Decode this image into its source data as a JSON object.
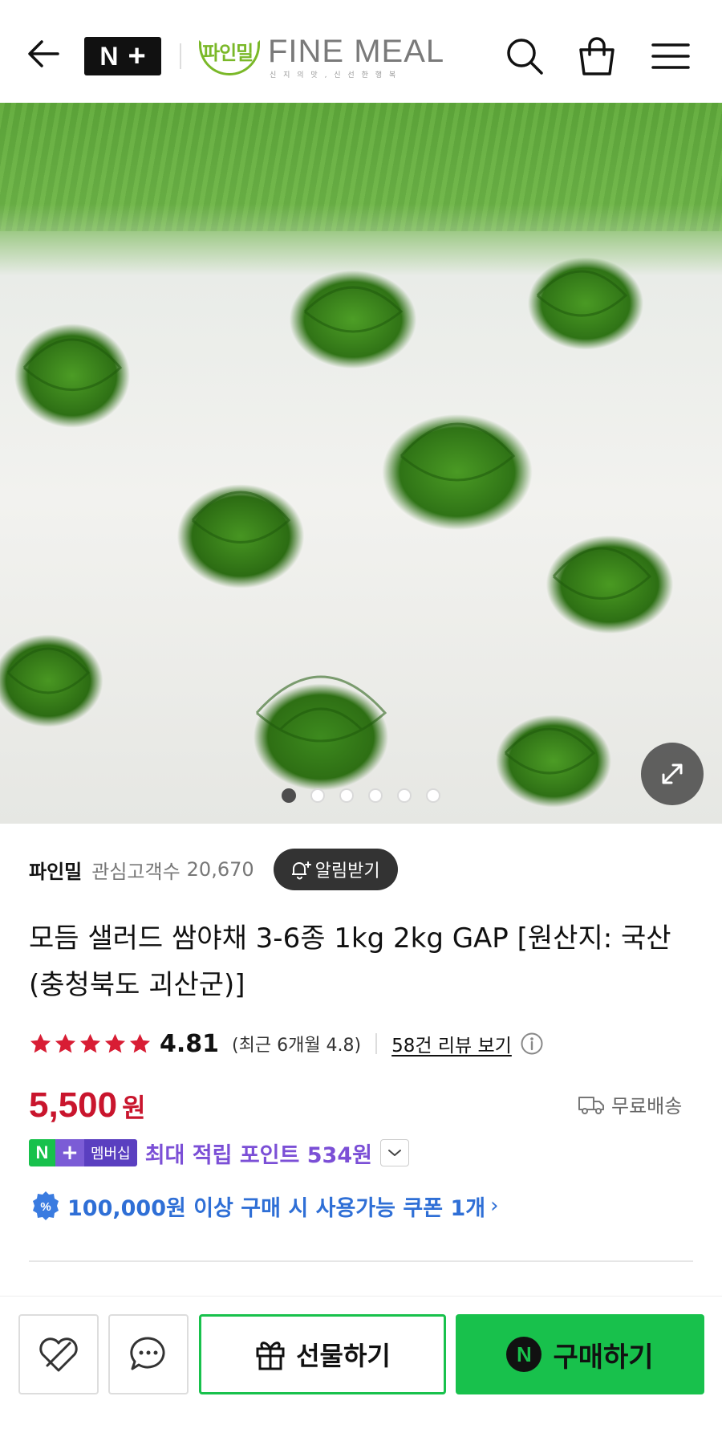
{
  "header": {
    "badge_n": "N",
    "badge_plus": "+",
    "brand_kr": "파인밀",
    "brand_en": "FINE MEAL",
    "brand_sub": "신 지 의 맛 , 신 선 한 행 복"
  },
  "gallery": {
    "dots": 6,
    "active_index": 0
  },
  "seller": {
    "name": "파인밀",
    "fav_label": "관심고객수",
    "fav_count": "20,670",
    "alert_label": "알림받기"
  },
  "product": {
    "title": "모듬 샐러드 쌈야채 3-6종 1kg 2kg GAP [원산지: 국산(충청북도 괴산군)]",
    "rating": {
      "stars": 5,
      "score": "4.81",
      "recent": "(최근 6개월 4.8)",
      "review_link": "58건 리뷰 보기"
    },
    "price": {
      "amount": "5,500",
      "unit": "원"
    },
    "shipping": "무료배송",
    "membership": {
      "badge_n": "N",
      "badge_plus": "+",
      "badge_text": "멤버십",
      "text": "최대 적립 포인트 534원"
    },
    "coupon": {
      "icon_symbol": "%",
      "text": "100,000원 이상 구매 시 사용가능 쿠폰 1개",
      "chevron": "›"
    }
  },
  "bottom_bar": {
    "gift_label": "선물하기",
    "buy_badge": "N",
    "buy_label": "구매하기"
  },
  "colors": {
    "price_red": "#c9152d",
    "naver_green": "#18c14c",
    "member_purple": "#7b4fd6",
    "coupon_blue": "#2f6fd6",
    "star_red": "#d81d34"
  }
}
